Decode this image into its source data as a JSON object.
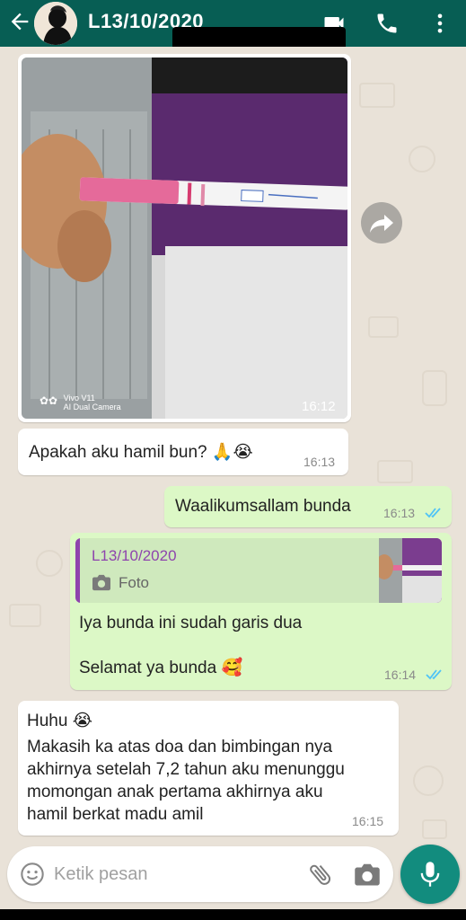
{
  "header": {
    "title": "L13/10/2020",
    "icons": [
      "back-arrow-icon",
      "video-call-icon",
      "phone-icon",
      "more-options-icon"
    ]
  },
  "messages": [
    {
      "id": "m1",
      "direction": "incoming",
      "type": "photo",
      "time": "16:12",
      "watermark_line1": "Vivo V11",
      "watermark_line2": "AI Dual Camera"
    },
    {
      "id": "m2",
      "direction": "incoming",
      "text": "Apakah aku hamil bun? 🙏😭",
      "time": "16:13"
    },
    {
      "id": "m3",
      "direction": "outgoing",
      "text": "Waalikumsallam bunda",
      "time": "16:13",
      "status": "read"
    },
    {
      "id": "m4",
      "direction": "outgoing",
      "time": "16:14",
      "status": "read",
      "reply_to": {
        "name": "L13/10/2020",
        "subtitle": "Foto"
      },
      "line1": "Iya bunda ini sudah garis dua",
      "line2": "Selamat ya bunda 🥰"
    },
    {
      "id": "m5",
      "direction": "incoming",
      "time": "16:15",
      "lines": [
        "Huhu 😭",
        "Makasih ka atas doa dan bimbingan nya",
        "akhirnya setelah 7,2 tahun aku menunggu",
        "momongan anak pertama akhirnya aku",
        "hamil berkat madu amil"
      ]
    }
  ],
  "composer": {
    "placeholder": "Ketik pesan",
    "value": ""
  },
  "colors": {
    "header": "#075e54",
    "outgoing": "#dcf8c6",
    "incoming": "#ffffff",
    "read_ticks": "#4fc3f7",
    "fab": "#128c7e"
  }
}
